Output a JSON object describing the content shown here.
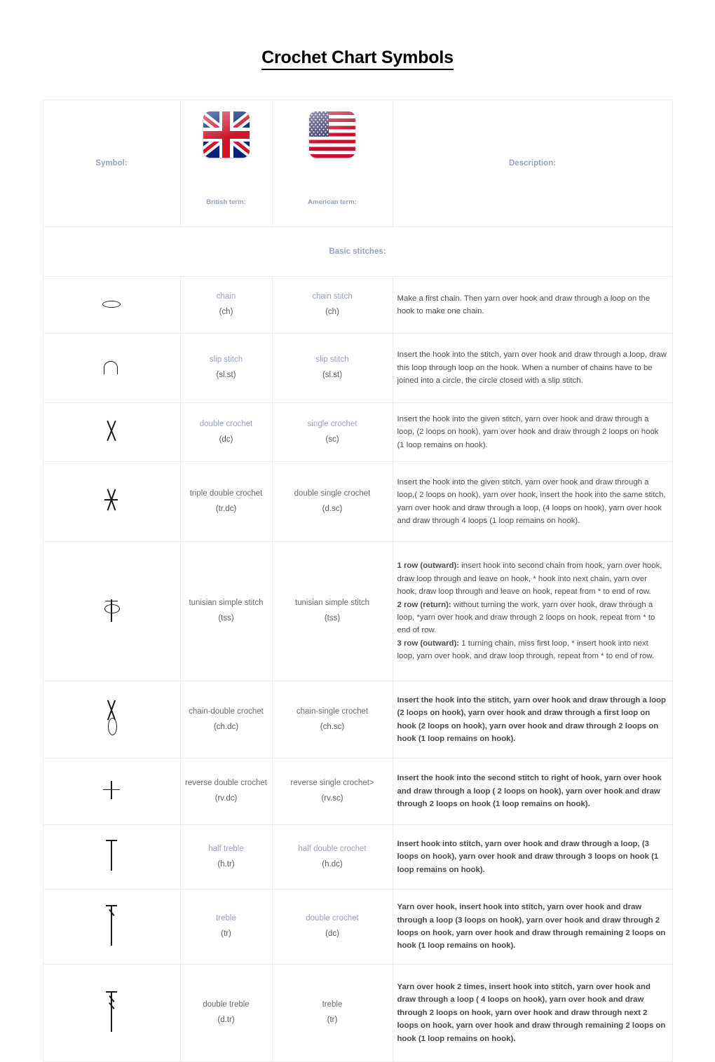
{
  "document": {
    "title": "Crochet Chart Symbols"
  },
  "table": {
    "headers": {
      "symbol": "Symbol:",
      "british": "British term:",
      "american": "American term:",
      "description": "Description:",
      "uk_flag_icon": "uk-flag-icon",
      "us_flag_icon": "us-flag-icon"
    },
    "section": "Basic stitches:",
    "rows": [
      {
        "symbol_icon": "chain-stitch-symbol",
        "british_name": "chain",
        "british_abbr": "(ch)",
        "american_name": "chain stitch",
        "american_abbr": "(ch)",
        "description": "Make a first chain. Then yarn over hook and draw through a loop on the hook to make one chain."
      },
      {
        "symbol_icon": "slip-stitch-symbol",
        "british_name": "slip stitch",
        "british_abbr": "(sl.st)",
        "american_name": "slip stitch",
        "american_abbr": "(sl.st)",
        "description": "Insert the hook into the stitch, yarn over hook and draw through a loop, draw this loop through loop on the hook. When a number of chains have to be joined into a circle, the circle closed with a slip stitch."
      },
      {
        "symbol_icon": "double-crochet-symbol",
        "british_name": "double crochet",
        "british_abbr": "(dc)",
        "american_name": "single crochet",
        "american_abbr": "(sc)",
        "description": "Insert the hook into the given stitch, yarn over hook and draw through a loop, (2 loops on hook), yarn over hook and draw through 2 loops on hook (1 loop remains on hook)."
      },
      {
        "symbol_icon": "triple-double-crochet-symbol",
        "british_name": "triple double crochet",
        "british_abbr": "(tr.dc)",
        "american_name": "double single crochet",
        "american_abbr": "(d.sc)",
        "description": "Insert the hook into the given stitch, yarn over hook and draw through a loop,( 2 loops on hook), yarn over hook, insert the hook into the same stitch, yarn over hook and draw through a loop, (4 loops on hook), yarn over hook and draw through 4 loops (1 loop remains on hook)."
      },
      {
        "symbol_icon": "tunisian-simple-stitch-symbol",
        "british_name": "tunisian simple stitch",
        "british_abbr": "(tss)",
        "american_name": "tunisian simple stitch",
        "american_abbr": "(tss)",
        "description_parts": [
          {
            "label": "1 row (outward):",
            "text": " insert hook into second chain from hook, yarn over hook, draw loop through and leave on hook, * hook into next chain, yarn over hook, draw loop through and leave on hook, repeat from * to end of row."
          },
          {
            "label": "2 row (return):",
            "text": " without turning the work, yarn over hook, draw through a loop, *yarn over hook and draw through 2 loops on hook, repeat from * to end of row."
          },
          {
            "label": "3 row (outward):",
            "text": " 1 turning chain, miss first loop, * insert hook into next loop, yarn over hook, and draw loop through, repeat from * to end of row."
          }
        ]
      },
      {
        "symbol_icon": "chain-double-crochet-symbol",
        "british_name": "chain-double crochet",
        "british_abbr": "(ch.dc)",
        "american_name": "chain-single crochet",
        "american_abbr": "(ch.sc)",
        "description": "Insert the hook into the stitch, yarn over hook and draw through a loop (2 loops on hook), yarn over hook and draw through a first loop on hook (2 loops on hook), yarn over hook and draw through 2 loops on hook (1 loop remains on hook)."
      },
      {
        "symbol_icon": "reverse-double-crochet-symbol",
        "british_name": "reverse double crochet",
        "british_abbr": "(rv.dc)",
        "american_name": "reverse single crochet>",
        "american_abbr": "(rv.sc)",
        "description": "Insert the hook into the second stitch to right of hook, yarn over hook and draw through a loop ( 2 loops on hook), yarn over hook and draw through 2 loops on hook (1 loop remains on hook)."
      },
      {
        "symbol_icon": "half-treble-symbol",
        "british_name": "half treble",
        "british_abbr": "(h.tr)",
        "american_name": "half double crochet",
        "american_abbr": "(h.dc)",
        "description": "Insert hook into stitch, yarn over hook and draw through a loop, (3 loops on hook), yarn over hook and draw through 3 loops on hook (1 loop remains on hook)."
      },
      {
        "symbol_icon": "treble-symbol",
        "british_name": "treble",
        "british_abbr": "(tr)",
        "american_name": "double crochet",
        "american_abbr": "(dc)",
        "description": "Yarn over hook, insert hook into stitch, yarn over hook and draw through a loop (3 loops on hook), yarn over hook and draw through 2 loops on hook, yarn over hook and draw through remaining 2 loops on hook (1 loop remains on hook)."
      },
      {
        "symbol_icon": "double-treble-symbol",
        "british_name": "double treble",
        "british_abbr": "(d.tr)",
        "american_name": "treble",
        "american_abbr": "(tr)",
        "description": "Yarn over hook 2 times, insert hook into stitch, yarn over hook and draw through a loop ( 4 loops on hook), yarn over hook and draw through 2 loops on hook, yarn over hook and draw through next 2 loops on hook, yarn over hook and draw through remaining 2 loops on hook (1 loop remains on hook)."
      }
    ]
  },
  "colors": {
    "accent_blue_gray": "#97a1c0",
    "border": "#ededed",
    "text": "#4d4d4d",
    "title": "#000000"
  }
}
